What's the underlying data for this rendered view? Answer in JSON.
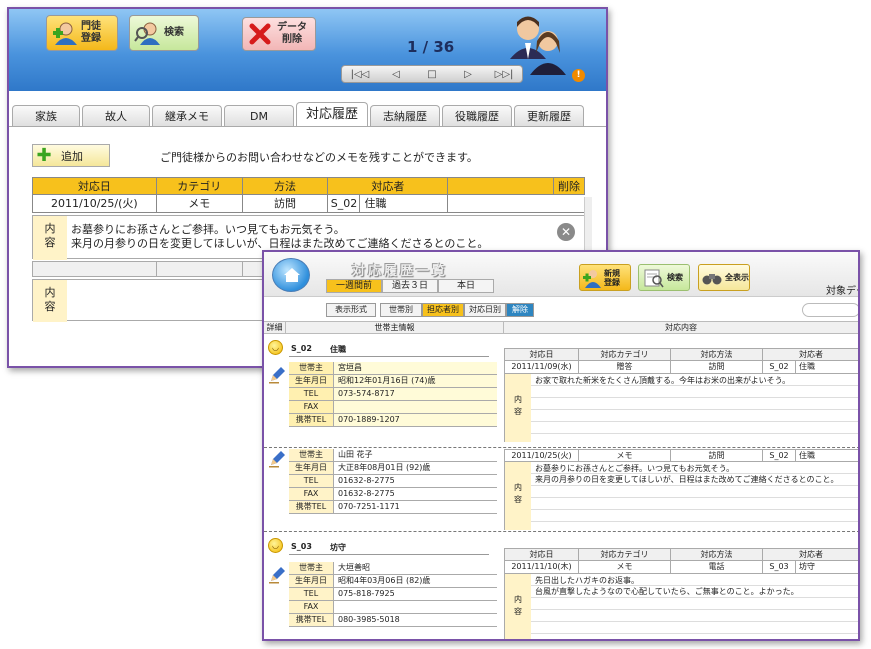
{
  "window1": {
    "header": {
      "member_register": "門徒\n登録",
      "search": "検索",
      "delete_data": "データ\n削除",
      "record_counter": "1 / 36",
      "nav": [
        "|◁◁",
        "◁",
        "□",
        "▷",
        "▷▷|"
      ],
      "warning_glyph": "!"
    },
    "tabs": [
      "家族",
      "故人",
      "継承メモ",
      "DM",
      "対応履歴",
      "志納履歴",
      "役職履歴",
      "更新履歴"
    ],
    "active_tab": "対応履歴",
    "add_button": "追加",
    "description": "ご門徒様からのお問い合わせなどのメモを残すことができます。",
    "table": {
      "headers": [
        "対応日",
        "カテゴリ",
        "方法",
        "対応者",
        "",
        "削除"
      ],
      "rows": [
        {
          "date": "2011/10/25/(火)",
          "category": "メモ",
          "method": "訪問",
          "staff_code": "S_02",
          "staff_role": "住職"
        }
      ],
      "content_label": "内容",
      "content_lines": [
        "お墓参りにお孫さんとご参拝。いつ見てもお元気そう。",
        "来月の月参りの日を変更してほしいが、日程はまた改めてご連絡くださるとのこと。"
      ],
      "close_glyph": "✕"
    }
  },
  "window2": {
    "title": "対応履歴一覧",
    "range_buttons": [
      "一週間前",
      "過去３日",
      "本日"
    ],
    "active_range": "一週間前",
    "buttons": {
      "new_register": "新規\n登録",
      "search": "検索",
      "show_all": "全表示"
    },
    "target_label": "対象デー",
    "filters": [
      "表示形式",
      "世帯別",
      "担応者別",
      "対応日別",
      "解除"
    ],
    "active_filter": "担応者別",
    "columns": {
      "detail": "詳細",
      "household": "世帯主情報",
      "response": "対応内容"
    },
    "response_headers": [
      "対応日",
      "対応カテゴリ",
      "対応方法",
      "対応者"
    ],
    "content_label": [
      "内",
      "容"
    ],
    "info_labels": [
      "世帯主",
      "生年月日",
      "TEL",
      "FAX",
      "携帯TEL"
    ],
    "records": [
      {
        "staff_code": "S_02",
        "staff_role": "住職",
        "households": [
          {
            "name": "宮垣昌",
            "birth": "昭和12年01月16日 (74)歳",
            "tel": "073-574-8717",
            "fax": "",
            "mobile": "070-1889-1207",
            "response": {
              "date": "2011/11/09(水)",
              "category": "贈答",
              "method": "訪問",
              "staff_code": "S_02",
              "staff_role": "住職",
              "content": [
                "お家で取れた新米をたくさん頂戴する。今年はお米の出来がよいそう。"
              ]
            }
          },
          {
            "name": "山田 花子",
            "birth": "大正8年08月01日 (92)歳",
            "tel": "01632-8-2775",
            "fax": "01632-8-2775",
            "mobile": "070-7251-1171",
            "response": {
              "date": "2011/10/25(火)",
              "category": "メモ",
              "method": "訪問",
              "staff_code": "S_02",
              "staff_role": "住職",
              "content": [
                "お墓参りにお孫さんとご参拝。いつ見てもお元気そう。",
                "来月の月参りの日を変更してほしいが、日程はまた改めてご連絡くださるとのこと。"
              ]
            }
          }
        ]
      },
      {
        "staff_code": "S_03",
        "staff_role": "坊守",
        "households": [
          {
            "name": "大垣善昭",
            "birth": "昭和4年03月06日 (82)歳",
            "tel": "075-818-7925",
            "fax": "",
            "mobile": "080-3985-5018",
            "response": {
              "date": "2011/11/10(木)",
              "category": "メモ",
              "method": "電話",
              "staff_code": "S_03",
              "staff_role": "坊守",
              "content": [
                "先日出したハガキのお返事。",
                "台風が直撃したようなので心配していたら、ご無事とのこと。よかった。"
              ]
            }
          }
        ]
      }
    ]
  },
  "colors": {
    "window_border": "#7a52a8",
    "header_blue": "#3a86d6",
    "table_header": "#f7c11c",
    "label_cream": "#fff3c8"
  }
}
